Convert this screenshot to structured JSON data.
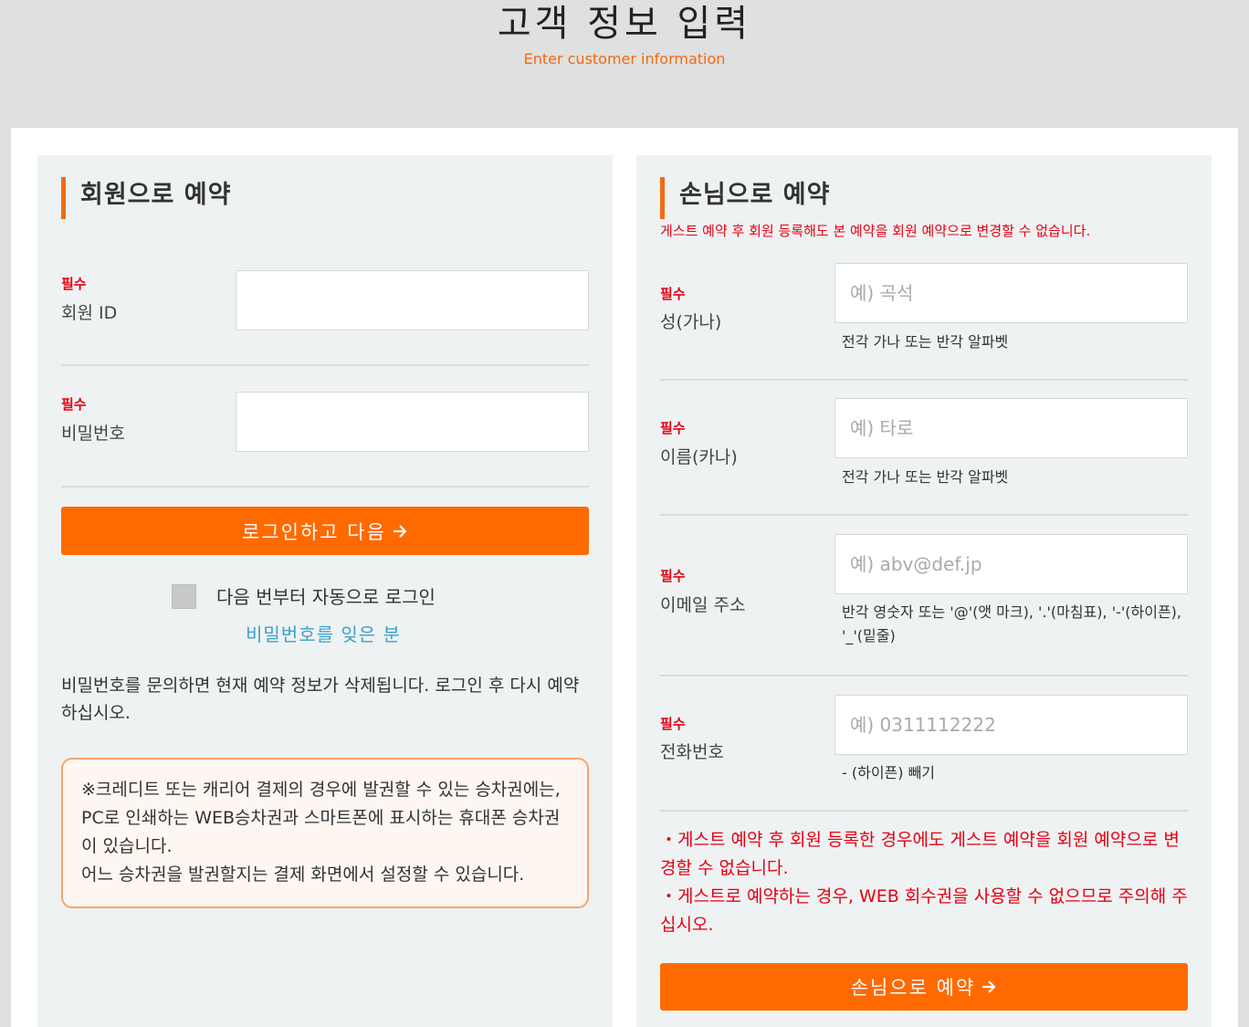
{
  "header": {
    "title": "고객 정보 입력",
    "subtitle": "Enter customer information"
  },
  "member": {
    "title": "회원으로 예약",
    "required_label": "필수",
    "id_label": "회원 ID",
    "id_value": "",
    "password_label": "비밀번호",
    "password_value": "",
    "login_button": "로그인하고 다음",
    "auto_login_label": "다음 번부터 자동으로 로그인",
    "auto_login_checked": false,
    "forgot_password_link": "비밀번호를 잊은 분",
    "inquiry_note": "비밀번호를 문의하면 현재 예약 정보가 삭제됩니다. 로그인 후 다시 예약하십시오.",
    "notice_line1": "※크레디트 또는 캐리어 결제의 경우에 발권할 수 있는 승차권에는, PC로 인쇄하는 WEB승차권과 스마트폰에 표시하는 휴대폰 승차권이 있습니다.",
    "notice_line2": "어느 승차권을 발권할지는 결제 화면에서 설정할 수 있습니다."
  },
  "guest": {
    "title": "손님으로 예약",
    "warning": "게스트 예약 후 회원 등록해도 본 예약을 회원 예약으로 변경할 수 없습니다.",
    "required_label": "필수",
    "last_name_label": "성(가나)",
    "last_name_placeholder": "예) 곡석",
    "last_name_hint": "전각 가나 또는 반각 알파벳",
    "first_name_label": "이름(카나)",
    "first_name_placeholder": "예) 타로",
    "first_name_hint": "전각 가나 또는 반각 알파벳",
    "email_label": "이메일 주소",
    "email_placeholder": "예) abv@def.jp",
    "email_hint": "반각 영숫자 또는 '@'(앳 마크), '.'(마침표), '-'(하이픈), '_'(밑줄)",
    "phone_label": "전화번호",
    "phone_placeholder": "예) 0311112222",
    "phone_hint": "- (하이픈) 빼기",
    "note1": "・게스트 예약 후 회원 등록한 경우에도 게스트 예약을 회원 예약으로 변경할 수 없습니다.",
    "note2": "・게스트로 예약하는 경우, WEB 회수권을 사용할 수 없으므로 주의해 주십시오.",
    "guest_button": "손님으로 예약"
  },
  "colors": {
    "accent": "#ff6a00",
    "required": "#e60012",
    "link": "#3ca0c8"
  }
}
